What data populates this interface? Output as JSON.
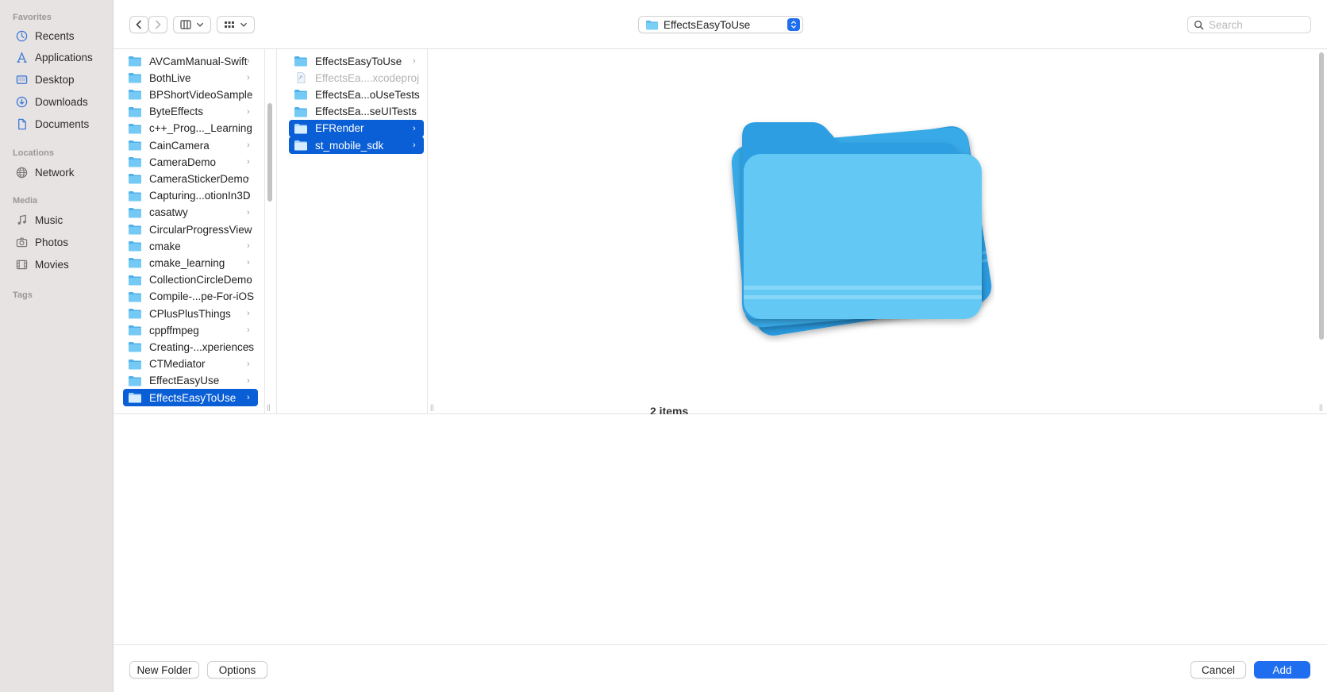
{
  "sidebar": {
    "sections": [
      {
        "title": "Favorites",
        "items": [
          {
            "label": "Recents",
            "icon": "clock-icon"
          },
          {
            "label": "Applications",
            "icon": "applications-icon"
          },
          {
            "label": "Desktop",
            "icon": "desktop-icon"
          },
          {
            "label": "Downloads",
            "icon": "download-icon"
          },
          {
            "label": "Documents",
            "icon": "document-icon"
          }
        ]
      },
      {
        "title": "Locations",
        "items": [
          {
            "label": "Network",
            "icon": "network-icon"
          }
        ]
      },
      {
        "title": "Media",
        "items": [
          {
            "label": "Music",
            "icon": "music-icon"
          },
          {
            "label": "Photos",
            "icon": "camera-icon"
          },
          {
            "label": "Movies",
            "icon": "film-icon"
          }
        ]
      },
      {
        "title": "Tags",
        "items": []
      }
    ]
  },
  "toolbar": {
    "current_folder": "EffectsEasyToUse",
    "search_placeholder": "Search"
  },
  "column1": {
    "items": [
      {
        "label": "AVCamManual-Swift",
        "selected": false
      },
      {
        "label": "BothLive",
        "selected": false
      },
      {
        "label": "BPShortVideoSample",
        "selected": false
      },
      {
        "label": "ByteEffects",
        "selected": false
      },
      {
        "label": "c++_Prog..._Learning",
        "selected": false
      },
      {
        "label": "CainCamera",
        "selected": false
      },
      {
        "label": "CameraDemo",
        "selected": false
      },
      {
        "label": "CameraStickerDemo",
        "selected": false
      },
      {
        "label": "Capturing...otionIn3D",
        "selected": false
      },
      {
        "label": "casatwy",
        "selected": false
      },
      {
        "label": "CircularProgressView",
        "selected": false
      },
      {
        "label": "cmake",
        "selected": false
      },
      {
        "label": "cmake_learning",
        "selected": false
      },
      {
        "label": "CollectionCircleDemo",
        "selected": false
      },
      {
        "label": "Compile-...pe-For-iOS",
        "selected": false
      },
      {
        "label": "CPlusPlusThings",
        "selected": false
      },
      {
        "label": "cppffmpeg",
        "selected": false
      },
      {
        "label": "Creating-...xperiences",
        "selected": false
      },
      {
        "label": "CTMediator",
        "selected": false
      },
      {
        "label": "EffectEasyUse",
        "selected": false
      },
      {
        "label": "EffectsEasyToUse",
        "selected": true
      }
    ]
  },
  "column2": {
    "items": [
      {
        "label": "EffectsEasyToUse",
        "selected": false,
        "dim": false,
        "folder": true
      },
      {
        "label": "EffectsEa....xcodeproj",
        "selected": false,
        "dim": true,
        "folder": false
      },
      {
        "label": "EffectsEa...oUseTests",
        "selected": false,
        "dim": false,
        "folder": true
      },
      {
        "label": "EffectsEa...seUITests",
        "selected": false,
        "dim": false,
        "folder": true
      },
      {
        "label": "EFRender",
        "selected": true,
        "dim": false,
        "folder": true
      },
      {
        "label": "st_mobile_sdk",
        "selected": true,
        "dim": false,
        "folder": true
      }
    ]
  },
  "preview": {
    "item_count": "2 items"
  },
  "bottom": {
    "new_folder_label": "New Folder",
    "options_label": "Options",
    "cancel_label": "Cancel",
    "add_label": "Add"
  },
  "colors": {
    "accent": "#1f6ef0",
    "selection": "#0a5fd6",
    "sidebar_bg": "#e8e3e3",
    "folder_blue": "#5cc4f2"
  }
}
